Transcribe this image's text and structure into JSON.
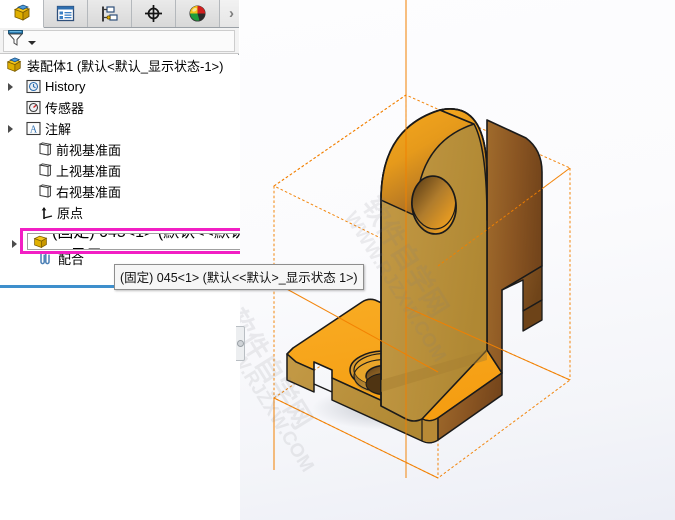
{
  "tabs": [
    {
      "name": "feature-manager-design-tree",
      "icon": "assembly-cube-icon",
      "active": true
    },
    {
      "name": "property-manager",
      "icon": "property-list-icon",
      "active": false
    },
    {
      "name": "configuration-manager",
      "icon": "configuration-icon",
      "active": false
    },
    {
      "name": "dimxpert-manager",
      "icon": "crosshair-target-icon",
      "active": false
    },
    {
      "name": "display-manager",
      "icon": "color-sphere-icon",
      "active": false
    }
  ],
  "tabs_overflow_label": "›",
  "filter": {
    "icon": "funnel-filter-icon",
    "dropdown_icon": "chevron-down-icon",
    "placeholder": ""
  },
  "tree": {
    "root": {
      "label": "装配体1  (默认<默认_显示状态-1>)",
      "icon": "assembly-cube-icon"
    },
    "items": [
      {
        "label": "History",
        "icon": "history-folder-icon",
        "expandable": true
      },
      {
        "label": "传感器",
        "icon": "sensor-folder-icon",
        "expandable": false
      },
      {
        "label": "注解",
        "icon": "annotations-folder-icon",
        "expandable": true
      },
      {
        "label": "前视基准面",
        "icon": "plane-icon",
        "expandable": false
      },
      {
        "label": "上视基准面",
        "icon": "plane-icon",
        "expandable": false
      },
      {
        "label": "右视基准面",
        "icon": "plane-icon",
        "expandable": false
      },
      {
        "label": "原点",
        "icon": "origin-icon",
        "expandable": false
      }
    ],
    "selected_item": {
      "label": "(固定) 045<1>  (默认<<默认>_显示",
      "icon": "part-cube-icon",
      "expandable": true,
      "highlight_color": "#f21fc4"
    },
    "mates_item": {
      "label": "配合",
      "icon": "mates-paperclip-icon"
    }
  },
  "tooltip": {
    "text": "(固定) 045<1>  (默认<<默认>_显示状态 1>)"
  },
  "viewport": {
    "watermark_lines": [
      "软件自学网",
      "WWW.RJZXW.COM"
    ],
    "bounding_box_color": "#f28000",
    "model_colors": {
      "top_face": "#f7a41e",
      "front_face": "#bb9140",
      "side_face": "#8c5a28",
      "edge": "#1a1a1a"
    }
  },
  "splitter": {
    "name": "panel-splitter-handle"
  },
  "drop_indicator": {
    "color": "#3e8fcc"
  }
}
